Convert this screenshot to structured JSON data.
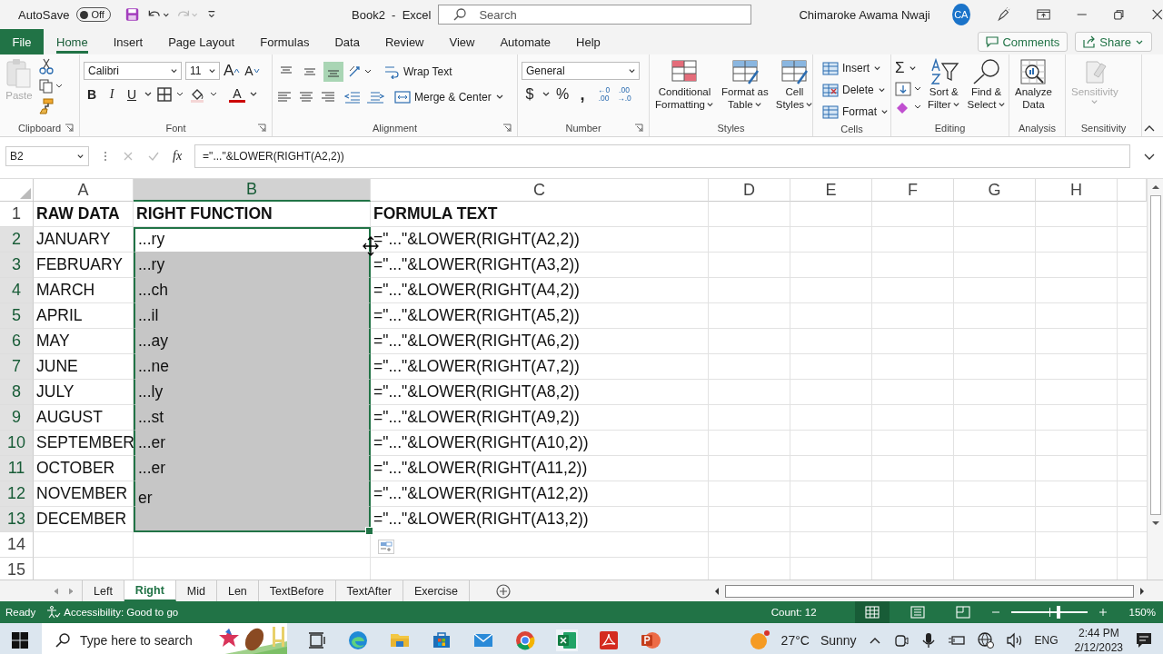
{
  "title_bar": {
    "autosave_label": "AutoSave",
    "autosave_on": false,
    "autosave_state": "Off",
    "title": "Book2  -  Excel",
    "search_placeholder": "Search",
    "user": "Chimaroke Awama Nwaji",
    "avatar": "CA"
  },
  "ribbon_tabs": [
    {
      "label": "File",
      "kind": "file",
      "selected": false
    },
    {
      "label": "Home",
      "kind": "tab",
      "selected": true
    },
    {
      "label": "Insert",
      "kind": "tab",
      "selected": false
    },
    {
      "label": "Page Layout",
      "kind": "tab",
      "selected": false
    },
    {
      "label": "Formulas",
      "kind": "tab",
      "selected": false
    },
    {
      "label": "Data",
      "kind": "tab",
      "selected": false
    },
    {
      "label": "Review",
      "kind": "tab",
      "selected": false
    },
    {
      "label": "View",
      "kind": "tab",
      "selected": false
    },
    {
      "label": "Automate",
      "kind": "tab",
      "selected": false
    },
    {
      "label": "Help",
      "kind": "tab",
      "selected": false
    }
  ],
  "ribbon_buttons": [
    "Comments",
    "Share"
  ],
  "clipboard": {
    "paste": "Paste",
    "group": "Clipboard"
  },
  "font": {
    "name": "Calibri",
    "size": "11",
    "grow": "A",
    "shrink": "A",
    "bold": "B",
    "italic": "I",
    "underline": "U",
    "color_button": "A",
    "group": "Font"
  },
  "alignment": {
    "vertical": [
      {
        "selected": false
      },
      {
        "selected": false
      },
      {
        "selected": true
      }
    ],
    "wrap": "Wrap Text",
    "merge": "Merge & Center",
    "group": "Alignment"
  },
  "number": {
    "format": "General",
    "currency": "$",
    "percent": "%",
    "comma": ",",
    "inc_decimal": [
      "←0",
      ".00"
    ],
    "dec_decimal": [
      ".00",
      "→.0"
    ],
    "group": "Number"
  },
  "styles": {
    "items": [
      [
        "Conditional",
        "Formatting"
      ],
      [
        "Format as",
        "Table"
      ],
      [
        "Cell",
        "Styles"
      ]
    ],
    "group": "Styles"
  },
  "cells": {
    "items": [
      "Insert",
      "Delete",
      "Format"
    ],
    "group": "Cells"
  },
  "editing": {
    "sum": "Σ",
    "items": [
      [
        "Sort &",
        "Filter"
      ],
      [
        "Find &",
        "Select"
      ]
    ],
    "group": "Editing"
  },
  "analysis": {
    "label": [
      "Analyze",
      "Data"
    ],
    "group": "Analysis"
  },
  "sensitivity": {
    "label": "Sensitivity",
    "disabled": true,
    "group": "Sensitivity"
  },
  "formula_bar": {
    "name_box": "B2",
    "fx": "fx",
    "formula": "=\"...\"&LOWER(RIGHT(A2,2))"
  },
  "columns": [
    {
      "label": "A",
      "selected": false
    },
    {
      "label": "B",
      "selected": true
    },
    {
      "label": "C",
      "selected": false
    },
    {
      "label": "D",
      "selected": false
    },
    {
      "label": "E",
      "selected": false
    },
    {
      "label": "F",
      "selected": false
    },
    {
      "label": "G",
      "selected": false
    },
    {
      "label": "H",
      "selected": false
    }
  ],
  "rows": [
    {
      "num": "1",
      "kind": "header",
      "selected": false,
      "active": false,
      "cells": {
        "a": "RAW DATA",
        "b": "RIGHT FUNCTION",
        "c": "FORMULA  TEXT"
      }
    },
    {
      "num": "2",
      "kind": "data",
      "selected": true,
      "active": true,
      "cells": {
        "a": "JANUARY",
        "b": "...ry",
        "c": "=\"...\"&LOWER(RIGHT(A2,2))"
      }
    },
    {
      "num": "3",
      "kind": "data",
      "selected": true,
      "active": false,
      "cells": {
        "a": "FEBRUARY",
        "b": "...ry",
        "c": "=\"...\"&LOWER(RIGHT(A3,2))"
      }
    },
    {
      "num": "4",
      "kind": "data",
      "selected": true,
      "active": false,
      "cells": {
        "a": "MARCH",
        "b": "...ch",
        "c": "=\"...\"&LOWER(RIGHT(A4,2))"
      }
    },
    {
      "num": "5",
      "kind": "data",
      "selected": true,
      "active": false,
      "cells": {
        "a": "APRIL",
        "b": "...il",
        "c": "=\"...\"&LOWER(RIGHT(A5,2))"
      }
    },
    {
      "num": "6",
      "kind": "data",
      "selected": true,
      "active": false,
      "cells": {
        "a": "MAY",
        "b": "...ay",
        "c": "=\"...\"&LOWER(RIGHT(A6,2))"
      }
    },
    {
      "num": "7",
      "kind": "data",
      "selected": true,
      "active": false,
      "cells": {
        "a": "JUNE",
        "b": "...ne",
        "c": "=\"...\"&LOWER(RIGHT(A7,2))"
      }
    },
    {
      "num": "8",
      "kind": "data",
      "selected": true,
      "active": false,
      "cells": {
        "a": "JULY",
        "b": "...ly",
        "c": "=\"...\"&LOWER(RIGHT(A8,2))"
      }
    },
    {
      "num": "9",
      "kind": "data",
      "selected": true,
      "active": false,
      "cells": {
        "a": "AUGUST",
        "b": "...st",
        "c": "=\"...\"&LOWER(RIGHT(A9,2))"
      }
    },
    {
      "num": "10",
      "kind": "data",
      "selected": true,
      "active": false,
      "cells": {
        "a": "SEPTEMBER",
        "b": "...er",
        "c": "=\"...\"&LOWER(RIGHT(A10,2))"
      }
    },
    {
      "num": "11",
      "kind": "data",
      "selected": true,
      "active": false,
      "cells": {
        "a": "OCTOBER",
        "b": "...er",
        "c": "=\"...\"&LOWER(RIGHT(A11,2))"
      }
    },
    {
      "num": "12",
      "kind": "data",
      "selected": true,
      "active": false,
      "cells": {
        "a": "NOVEMBER",
        "b": "er",
        "c": "=\"...\"&LOWER(RIGHT(A12,2))"
      }
    },
    {
      "num": "13",
      "kind": "data",
      "selected": true,
      "active": false,
      "cells": {
        "a": "DECEMBER",
        "c": "=\"...\"&LOWER(RIGHT(A13,2))"
      }
    },
    {
      "num": "14",
      "kind": "data",
      "selected": false,
      "active": false
    },
    {
      "num": "15",
      "kind": "data",
      "selected": false,
      "active": false
    }
  ],
  "sheet_tabs": [
    {
      "label": "Left",
      "selected": false
    },
    {
      "label": "Right",
      "selected": true
    },
    {
      "label": "Mid",
      "selected": false
    },
    {
      "label": "Len",
      "selected": false
    },
    {
      "label": "TextBefore",
      "selected": false
    },
    {
      "label": "TextAfter",
      "selected": false
    },
    {
      "label": "Exercise",
      "selected": false
    }
  ],
  "status": {
    "ready": "Ready",
    "accessibility": "Accessibility: Good to go",
    "count": "Count: 12",
    "views": [
      {
        "selected": true
      },
      {
        "selected": false
      },
      {
        "selected": false
      }
    ],
    "zoom_slider": {
      "level": 0.62
    },
    "zoom": "150%"
  },
  "taskbar": {
    "search_placeholder": "Type here to search",
    "temp": "27°C",
    "weather": "Sunny",
    "lang": "ENG",
    "time": "2:44 PM",
    "date": "2/12/2023"
  }
}
